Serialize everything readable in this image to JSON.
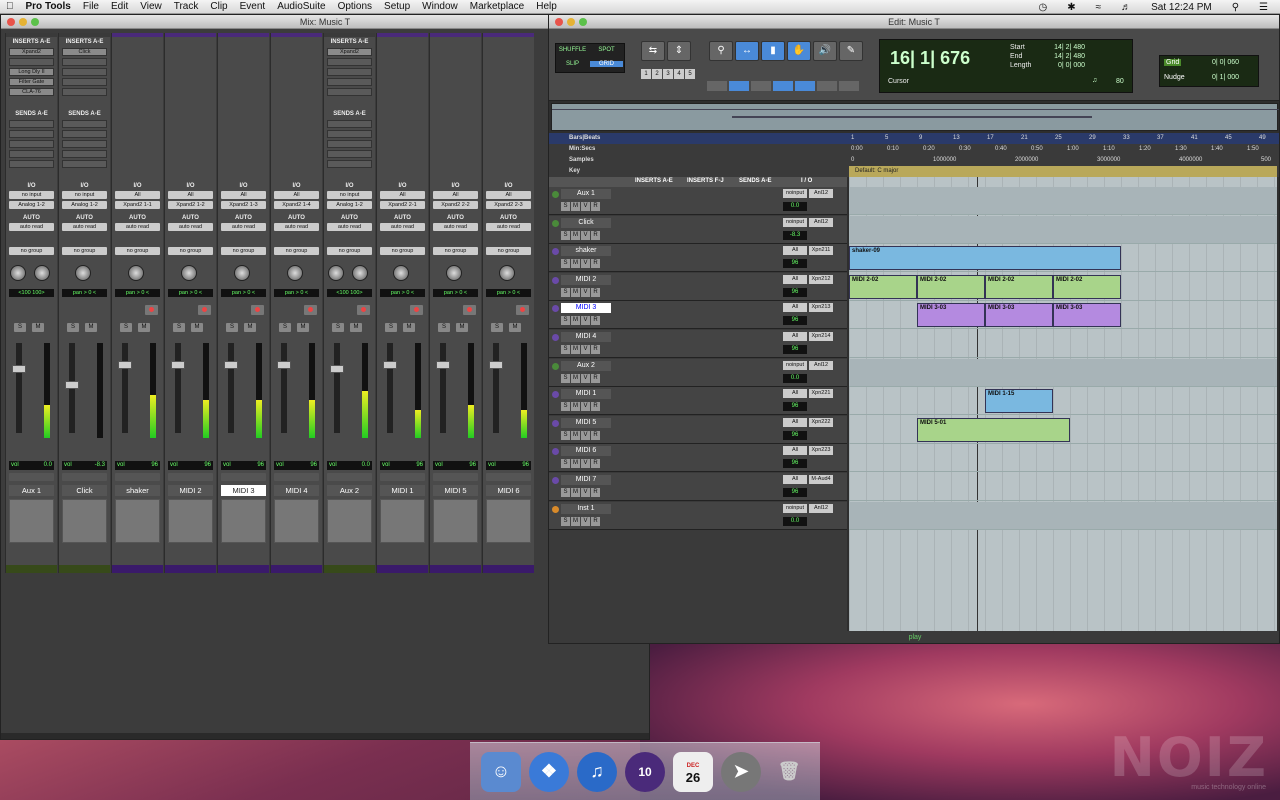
{
  "menubar": {
    "apple": "",
    "app": "Pro Tools",
    "items": [
      "File",
      "Edit",
      "View",
      "Track",
      "Clip",
      "Event",
      "AudioSuite",
      "Options",
      "Setup",
      "Window",
      "Marketplace",
      "Help"
    ],
    "clock": "Sat 12:24 PM"
  },
  "mixer": {
    "title": "Mix: Music T",
    "strips": [
      {
        "name": "Aux 1",
        "inserts_label": "INSERTS A-E",
        "inserts": [
          "Xpand2",
          "",
          "Long Dly II",
          "Filter Gate",
          "CLA-76"
        ],
        "sends_label": "SENDS A-E",
        "io_label": "I/O",
        "in": "no input",
        "out": "Analog 1-2",
        "auto_label": "AUTO",
        "auto": "auto read",
        "group": "no group",
        "pan": "<100   100>",
        "vol": "0.0",
        "purple": false,
        "knobs": 2
      },
      {
        "name": "Click",
        "inserts_label": "INSERTS A-E",
        "inserts": [
          "Click",
          "",
          "",
          "",
          ""
        ],
        "sends_label": "SENDS A-E",
        "io_label": "I/O",
        "in": "no input",
        "out": "Analog 1-2",
        "auto_label": "AUTO",
        "auto": "auto read",
        "group": "no group",
        "pan": "pan  > 0 <",
        "vol": "-8.3",
        "purple": false,
        "knobs": 1
      },
      {
        "name": "shaker",
        "inserts_label": "",
        "inserts": [],
        "sends_label": "",
        "io_label": "I/O",
        "in": "All",
        "out": "Xpand2 1-1",
        "auto_label": "AUTO",
        "auto": "auto read",
        "group": "no group",
        "pan": "pan  > 0 <",
        "vol": "96",
        "purple": true,
        "knobs": 1
      },
      {
        "name": "MIDI 2",
        "inserts_label": "",
        "inserts": [],
        "sends_label": "",
        "io_label": "I/O",
        "in": "All",
        "out": "Xpand2 1-2",
        "auto_label": "AUTO",
        "auto": "auto read",
        "group": "no group",
        "pan": "pan  > 0 <",
        "vol": "96",
        "purple": true,
        "knobs": 1
      },
      {
        "name": "MIDI 3",
        "inserts_label": "",
        "inserts": [],
        "sends_label": "",
        "io_label": "I/O",
        "in": "All",
        "out": "Xpand2 1-3",
        "auto_label": "AUTO",
        "auto": "auto read",
        "group": "no group",
        "pan": "pan  > 0 <",
        "vol": "96",
        "purple": true,
        "knobs": 1,
        "sel": true
      },
      {
        "name": "MIDI 4",
        "inserts_label": "",
        "inserts": [],
        "sends_label": "",
        "io_label": "I/O",
        "in": "All",
        "out": "Xpand2 1-4",
        "auto_label": "AUTO",
        "auto": "auto read",
        "group": "no group",
        "pan": "pan  > 0 <",
        "vol": "96",
        "purple": true,
        "knobs": 1
      },
      {
        "name": "Aux 2",
        "inserts_label": "INSERTS A-E",
        "inserts": [
          "Xpand2",
          "",
          "",
          "",
          ""
        ],
        "sends_label": "SENDS A-E",
        "io_label": "I/O",
        "in": "no input",
        "out": "Analog 1-2",
        "auto_label": "AUTO",
        "auto": "auto read",
        "group": "no group",
        "pan": "<100   100>",
        "vol": "0.0",
        "purple": false,
        "knobs": 2
      },
      {
        "name": "MIDI 1",
        "inserts_label": "",
        "inserts": [],
        "sends_label": "",
        "io_label": "I/O",
        "in": "All",
        "out": "Xpand2 2-1",
        "auto_label": "AUTO",
        "auto": "auto read",
        "group": "no group",
        "pan": "pan  > 0 <",
        "vol": "96",
        "purple": true,
        "knobs": 1
      },
      {
        "name": "MIDI 5",
        "inserts_label": "",
        "inserts": [],
        "sends_label": "",
        "io_label": "I/O",
        "in": "All",
        "out": "Xpand2 2-2",
        "auto_label": "AUTO",
        "auto": "auto read",
        "group": "no group",
        "pan": "pan  > 0 <",
        "vol": "96",
        "purple": true,
        "knobs": 1
      },
      {
        "name": "MIDI 6",
        "inserts_label": "",
        "inserts": [],
        "sends_label": "",
        "io_label": "I/O",
        "in": "All",
        "out": "Xpand2 2-3",
        "auto_label": "AUTO",
        "auto": "auto read",
        "group": "no group",
        "pan": "pan  > 0 <",
        "vol": "96",
        "purple": true,
        "knobs": 1
      }
    ]
  },
  "edit": {
    "title": "Edit: Music T",
    "modes": {
      "shuffle": "SHUFFLE",
      "spot": "SPOT",
      "slip": "SLIP",
      "grid": "GRID"
    },
    "zoom_presets": [
      "1",
      "2",
      "3",
      "4",
      "5"
    ],
    "counter": {
      "main": "16| 1| 676",
      "start_label": "Start",
      "end_label": "End",
      "length_label": "Length",
      "start": "14| 2| 480",
      "end": "14| 2| 480",
      "length": "0| 0| 000",
      "cursor_label": "Cursor",
      "tempo": "80"
    },
    "grid": {
      "grid_label": "Grid",
      "grid_val": "0| 0| 060",
      "nudge_label": "Nudge",
      "nudge_val": "0| 1| 000"
    },
    "rulers": {
      "bars_label": "Bars|Beats",
      "minsecs_label": "Min:Secs",
      "samples_label": "Samples",
      "key_label": "Key",
      "key_value": "Default: C major",
      "bars": [
        "1",
        "5",
        "9",
        "13",
        "17",
        "21",
        "25",
        "29",
        "33",
        "37",
        "41",
        "45",
        "49"
      ],
      "mins": [
        "0:00",
        "0:10",
        "0:20",
        "0:30",
        "0:40",
        "0:50",
        "1:00",
        "1:10",
        "1:20",
        "1:30",
        "1:40",
        "1:50"
      ],
      "samples": [
        "0",
        "1000000",
        "2000000",
        "3000000",
        "4000000",
        "500"
      ]
    },
    "columns": {
      "inserts_ae": "INSERTS A-E",
      "inserts_fj": "INSERTS F-J",
      "sends": "SENDS A-E",
      "io": "I / O"
    },
    "tracks": [
      {
        "name": "Aux 1",
        "in": "noinput",
        "out": "Anl12",
        "vol": "0.0",
        "type": "aux"
      },
      {
        "name": "Click",
        "in": "noinput",
        "out": "Anl12",
        "vol": "-8.3",
        "type": "aux"
      },
      {
        "name": "shaker",
        "in": "All",
        "out": "Xpn211",
        "vol": "96",
        "type": "midi"
      },
      {
        "name": "MIDI 2",
        "in": "All",
        "out": "Xpn212",
        "vol": "96",
        "type": "midi"
      },
      {
        "name": "MIDI 3",
        "in": "All",
        "out": "Xpn213",
        "vol": "96",
        "type": "midi",
        "sel": true
      },
      {
        "name": "MIDI 4",
        "in": "All",
        "out": "Xpn214",
        "vol": "96",
        "type": "midi"
      },
      {
        "name": "Aux 2",
        "in": "noinput",
        "out": "Anl12",
        "vol": "0.0",
        "type": "aux"
      },
      {
        "name": "MIDI 1",
        "in": "All",
        "out": "Xpn221",
        "vol": "96",
        "type": "midi"
      },
      {
        "name": "MIDI 5",
        "in": "All",
        "out": "Xpn222",
        "vol": "96",
        "type": "midi"
      },
      {
        "name": "MIDI 6",
        "in": "All",
        "out": "Xpn223",
        "vol": "96",
        "type": "midi"
      },
      {
        "name": "MIDI 7",
        "in": "All",
        "out": "M-Aud4",
        "vol": "96",
        "type": "midi"
      },
      {
        "name": "Inst 1",
        "in": "noinput",
        "out": "Anl12",
        "vol": "0.0",
        "type": "inst"
      }
    ],
    "clips": {
      "shaker": "shaker-09",
      "midi2": "MIDI 2-02",
      "midi3": "MIDI 3-03",
      "midi1": "MIDI 1-15",
      "midi5": "MIDI 5-01"
    },
    "status": "play"
  },
  "watermark": {
    "brand": "NOIZ",
    "sub": "music technology online"
  },
  "dock": {
    "calendar_month": "DEC",
    "calendar_day": "26",
    "pt_version": "10"
  }
}
